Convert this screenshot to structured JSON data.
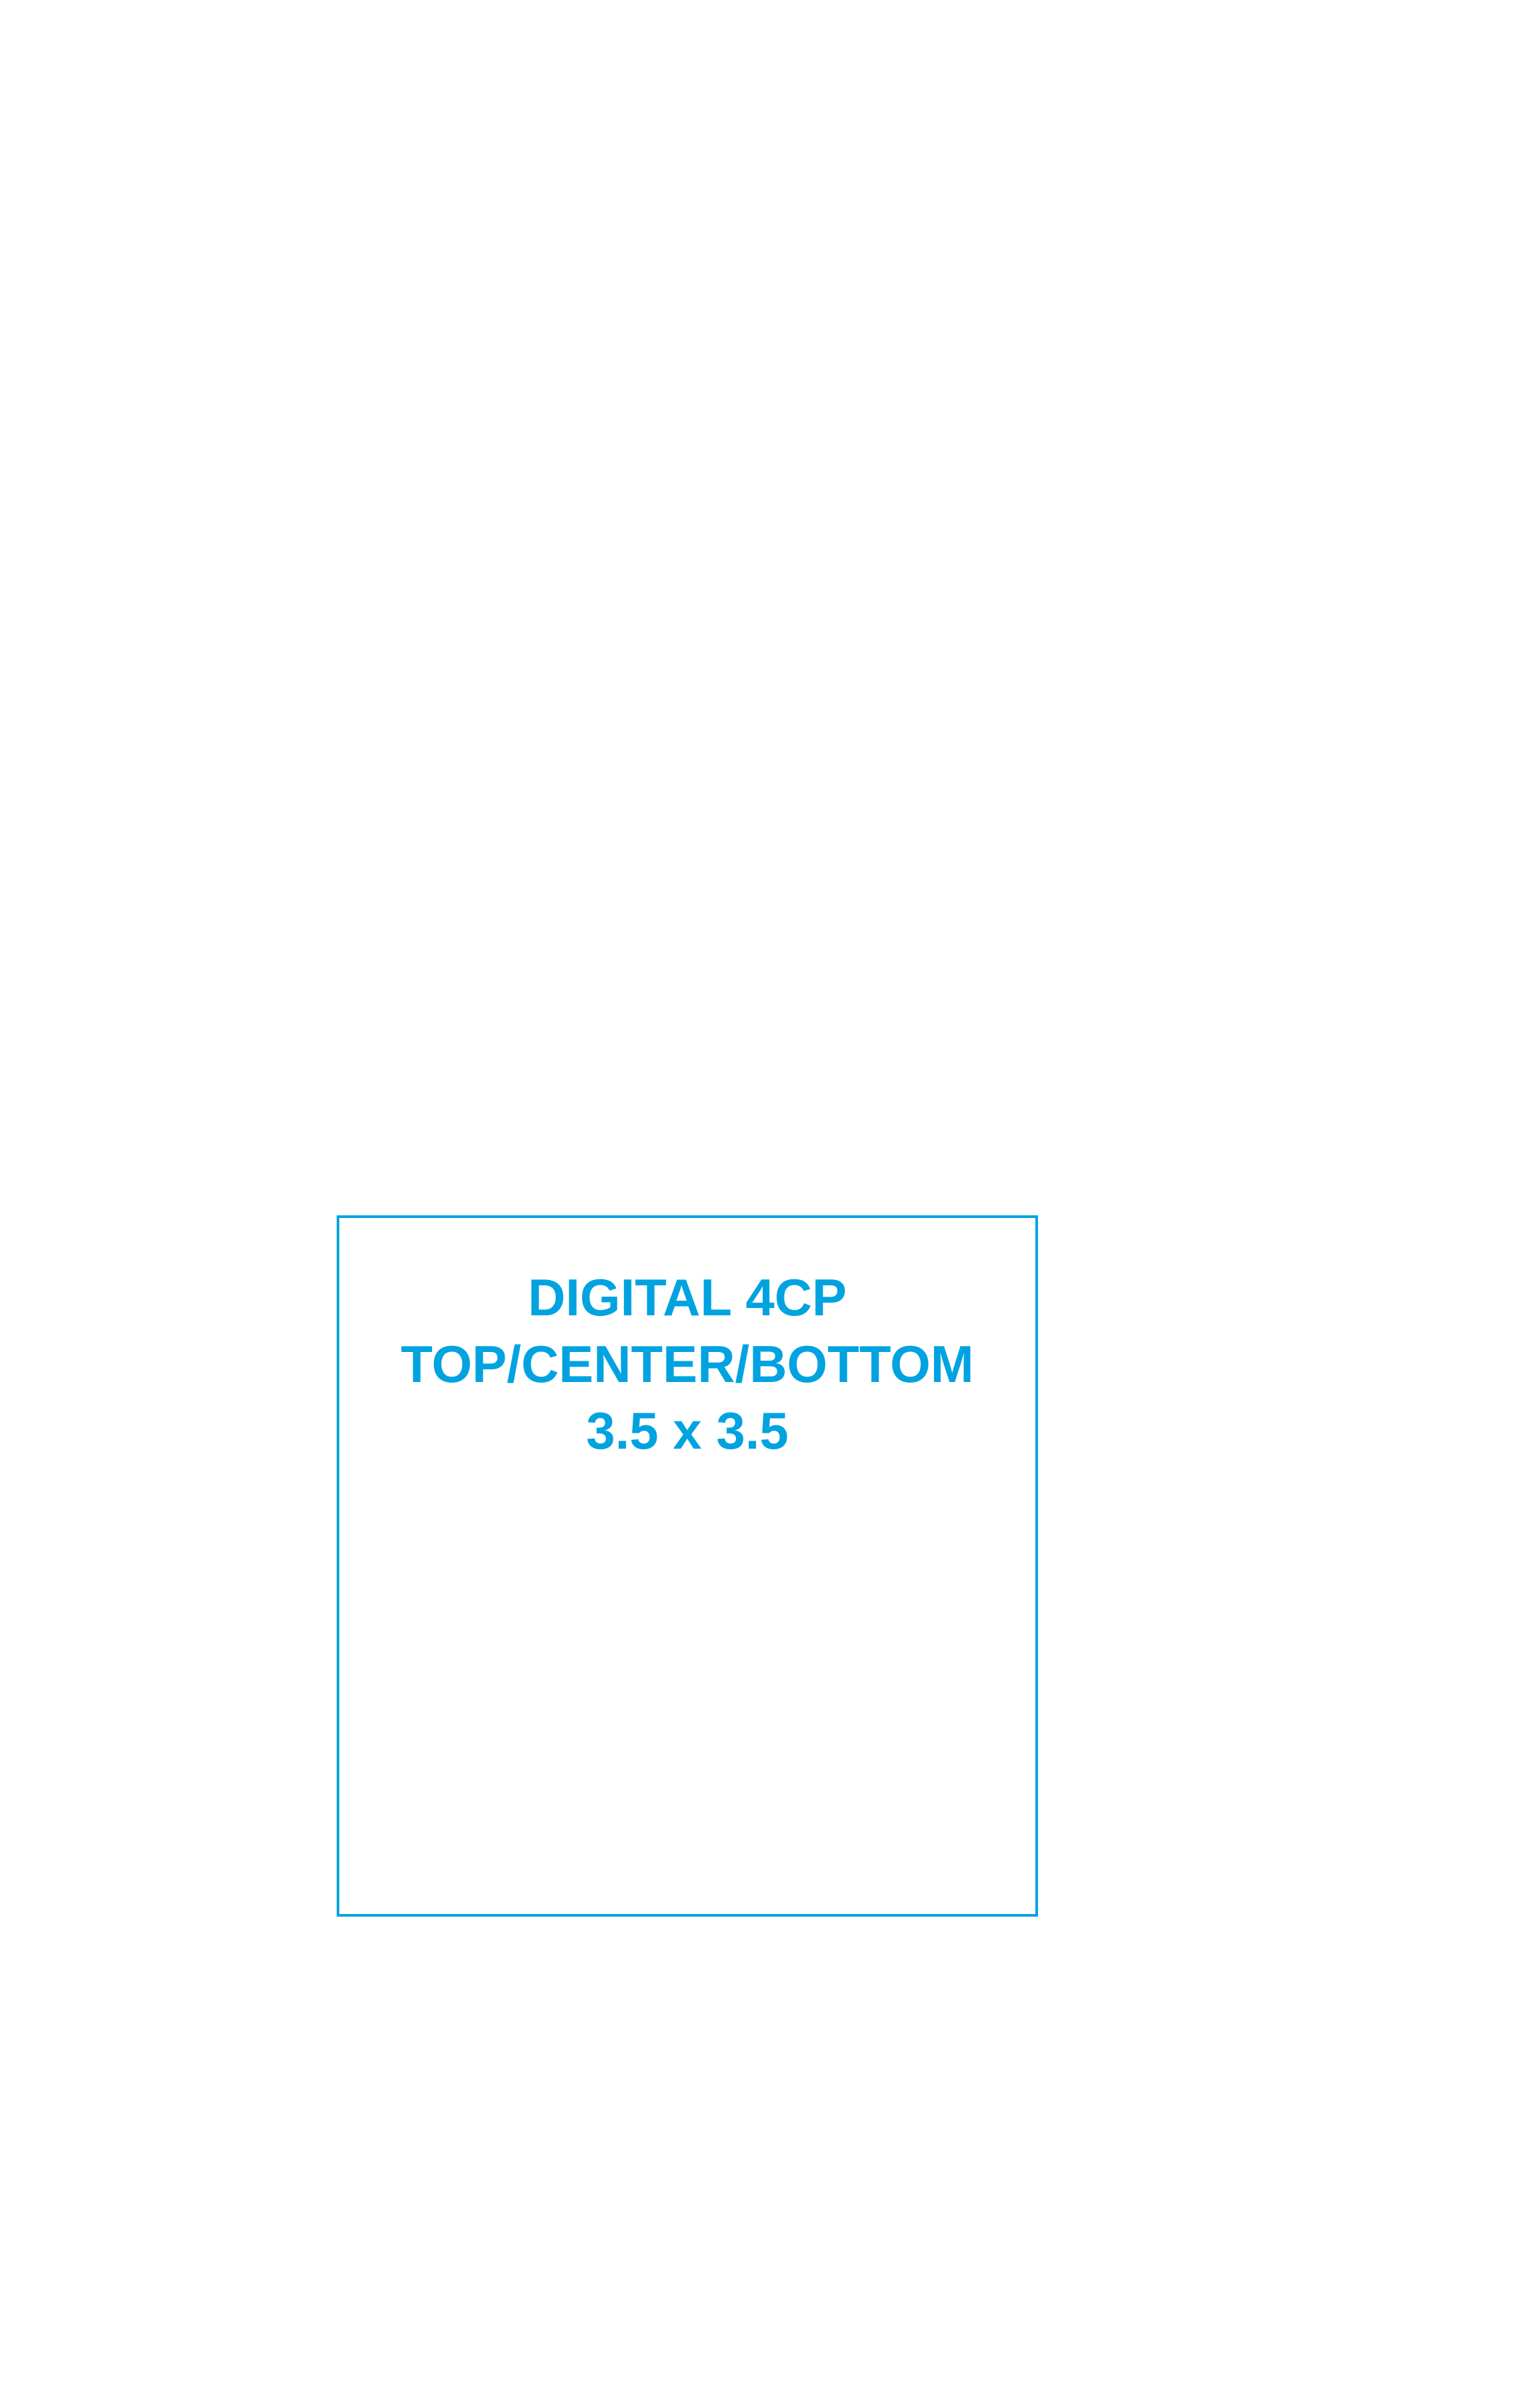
{
  "imprint": {
    "line1": "DIGITAL 4CP",
    "line2": "TOP/CENTER/BOTTOM",
    "line3": "3.5 x 3.5",
    "accent_color": "#00a3e0"
  }
}
